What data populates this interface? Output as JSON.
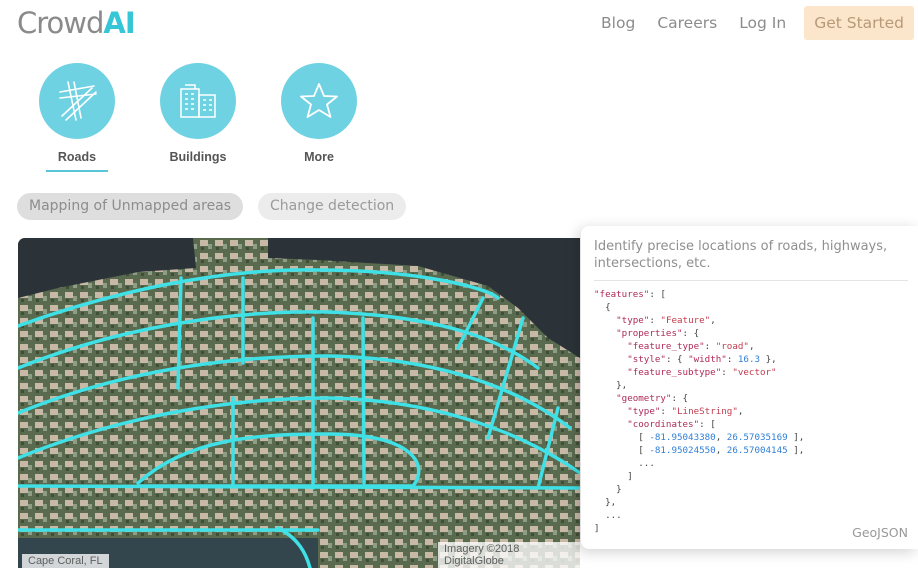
{
  "logo": {
    "text": "Crowd",
    "accent": "AI"
  },
  "nav": {
    "blog": "Blog",
    "careers": "Careers",
    "login": "Log In",
    "cta": "Get Started"
  },
  "categories": [
    {
      "label": "Roads",
      "icon": "roads-icon",
      "selected": true
    },
    {
      "label": "Buildings",
      "icon": "buildings-icon",
      "selected": false
    },
    {
      "label": "More",
      "icon": "star-icon",
      "selected": false
    }
  ],
  "modes": {
    "mapping": "Mapping of Unmapped areas",
    "change": "Change detection",
    "active": "mapping"
  },
  "map": {
    "location": "Cape Coral, FL",
    "credit": "Imagery ©2018 DigitalGlobe"
  },
  "panel": {
    "description": "Identify precise locations of roads, highways, intersections, etc.",
    "format": "GeoJSON",
    "code": {
      "features_key": "\"features\"",
      "type_key": "\"type\"",
      "type_val": "\"Feature\"",
      "properties_key": "\"properties\"",
      "feature_type_key": "\"feature_type\"",
      "feature_type_val": "\"road\"",
      "style_key": "\"style\"",
      "width_key": "\"width\"",
      "width_val": "16.3",
      "subtype_key": "\"feature_subtype\"",
      "subtype_val": "\"vector\"",
      "geometry_key": "\"geometry\"",
      "geom_type_val": "\"LineString\"",
      "coordinates_key": "\"coordinates\"",
      "c1_lon": "-81.95043380",
      "c1_lat": "26.57035169",
      "c2_lon": "-81.95024550",
      "c2_lat": "26.57004145"
    }
  },
  "colors": {
    "accent": "#35c6d8",
    "circle": "#6fd2e2",
    "road_overlay": "#3fe0e6",
    "cta_bg": "#fbe6cc"
  }
}
